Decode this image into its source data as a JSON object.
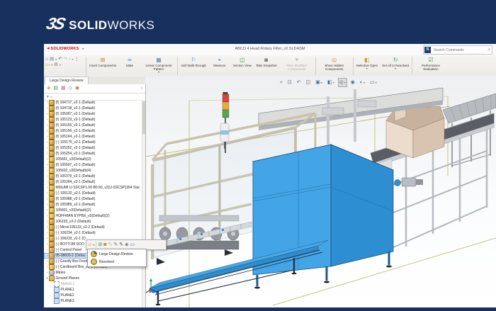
{
  "brand": {
    "mark": "3S",
    "wordmark_bold": "SOLID",
    "wordmark_light": "WORKS"
  },
  "titlebar": {
    "logo": "SOLIDWORKS",
    "menu_arrow": "▸",
    "title": "ABCO 4 Head Rotary Filler_v2.SLDASM",
    "search_badge": "S",
    "search_placeholder": "Search Commands"
  },
  "quick_access": [
    {
      "name": "home",
      "glyph": "⌂",
      "color": "#3a6fb0",
      "drop": false
    },
    {
      "name": "save",
      "glyph": "▤",
      "color": "#5a7db0",
      "drop": true
    },
    {
      "name": "undo",
      "glyph": "↶",
      "color": "#3a6fb0",
      "drop": false
    },
    {
      "name": "redo",
      "glyph": "↷",
      "color": "#b8b6b3",
      "drop": false
    },
    {
      "name": "new-document",
      "glyph": "▫",
      "color": "#c59a2f",
      "drop": true
    },
    {
      "name": "rebuild-traffic-light",
      "glyph": "⋮",
      "color": "#cc3333",
      "drop": false
    },
    {
      "name": "open-folder",
      "glyph": "▭",
      "color": "#c59a2f",
      "drop": true
    },
    {
      "name": "options",
      "glyph": "⚙",
      "color": "#787672",
      "drop": true
    }
  ],
  "commandmanager": {
    "buttons": [
      {
        "label": "Insert Components",
        "glyph": "⊞",
        "color": "#b8862d",
        "enabled": true,
        "group": 0,
        "drop": false
      },
      {
        "label": "Mate",
        "glyph": "∞",
        "color": "#2f7fbf",
        "enabled": true,
        "group": 0,
        "drop": false
      },
      {
        "label": "Linear Component Pattern",
        "glyph": "▦",
        "color": "#6a7fb0",
        "enabled": true,
        "group": 0,
        "drop": true
      },
      {
        "label": "Add Walk-through",
        "glyph": "⚐",
        "color": "#3f7fc0",
        "enabled": true,
        "group": 1,
        "drop": false
      },
      {
        "label": "Measure",
        "glyph": "⌖",
        "color": "#2f7fbf",
        "enabled": true,
        "group": 1,
        "drop": false
      },
      {
        "label": "Section View",
        "glyph": "◫",
        "color": "#3fa14c",
        "enabled": true,
        "group": 1,
        "drop": false
      },
      {
        "label": "Take Snapshot",
        "glyph": "◙",
        "color": "#6f6d6a",
        "enabled": true,
        "group": 1,
        "drop": false
      },
      {
        "label": "Filter Modified Components",
        "glyph": "▼",
        "color": "#c3c1be",
        "enabled": false,
        "group": 1,
        "drop": false
      },
      {
        "label": "Show Hidden Components",
        "glyph": "◎",
        "color": "#c59a2f",
        "enabled": true,
        "group": 2,
        "drop": false
      },
      {
        "label": "Selective Open",
        "glyph": "◧",
        "color": "#c59a2f",
        "enabled": true,
        "group": 3,
        "drop": true
      },
      {
        "label": "Set All to Resolved",
        "glyph": "↻",
        "color": "#3fa14c",
        "enabled": true,
        "group": 3,
        "drop": true
      },
      {
        "label": "Performance Evaluation",
        "glyph": "☑",
        "color": "#3fa14c",
        "enabled": true,
        "group": 4,
        "drop": false
      }
    ]
  },
  "tabs": {
    "active": "Large Design Review"
  },
  "panel": {
    "filter_glyph": "▼",
    "expand_arrow": "›",
    "tabs": [
      {
        "name": "featuremanager-tree-tab",
        "glyph": "◈",
        "color": "#c59a2f"
      },
      {
        "name": "propertymanager-tab",
        "glyph": "▤",
        "color": "#3fa14c"
      },
      {
        "name": "configurationmanager-tab",
        "glyph": "▦",
        "color": "#b86fb0"
      },
      {
        "name": "dimxpertmanager-tab",
        "glyph": "◇",
        "color": "#3a6fb0"
      },
      {
        "name": "displaymanager-tab",
        "glyph": "◉",
        "color": "#d66a2f"
      }
    ]
  },
  "tree": {
    "items": [
      {
        "label": "(f) 104717_v2-1 (Default)",
        "icon": "assembly",
        "expand": "c",
        "indent": 0,
        "selected": false,
        "dimmed": false
      },
      {
        "label": "(f) 104718_v2-1 (Default)",
        "icon": "assembly",
        "expand": "c",
        "indent": 0,
        "selected": false,
        "dimmed": false
      },
      {
        "label": "(f) 105007_v2-1 (Default)",
        "icon": "assembly",
        "expand": "c",
        "indent": 0,
        "selected": false,
        "dimmed": false
      },
      {
        "label": "(f) 105123_v2-1 (Default)",
        "icon": "assembly",
        "expand": "c",
        "indent": 0,
        "selected": false,
        "dimmed": false
      },
      {
        "label": "(f) 105155_v2-1 (Default)",
        "icon": "assembly",
        "expand": "c",
        "indent": 0,
        "selected": false,
        "dimmed": false
      },
      {
        "label": "(f) 105156_v2-1 (Default)",
        "icon": "assembly",
        "expand": "c",
        "indent": 0,
        "selected": false,
        "dimmed": false
      },
      {
        "label": "(f) 105164_v2-1 (Default)",
        "icon": "assembly",
        "expand": "c",
        "indent": 0,
        "selected": false,
        "dimmed": false
      },
      {
        "label": "(-) 105170_v2-1 (Default)",
        "icon": "assembly",
        "expand": "c",
        "indent": 0,
        "selected": false,
        "dimmed": false
      },
      {
        "label": "(f) 105252_v2-1 (Default)",
        "icon": "assembly",
        "expand": "c",
        "indent": 0,
        "selected": false,
        "dimmed": false
      },
      {
        "label": "(f) 105254_v2-1 (Default)",
        "icon": "assembly",
        "expand": "c",
        "indent": 0,
        "selected": false,
        "dimmed": false
      },
      {
        "label": "105601_v2(Default)(2)",
        "icon": "part",
        "expand": "c",
        "indent": 0,
        "selected": false,
        "dimmed": false
      },
      {
        "label": "(f) 105507_v2-1 (Default)",
        "icon": "assembly",
        "expand": "c",
        "indent": 0,
        "selected": false,
        "dimmed": false
      },
      {
        "label": "105602_v2(Default)(4)",
        "icon": "part",
        "expand": "c",
        "indent": 0,
        "selected": false,
        "dimmed": false
      },
      {
        "label": "(f) 105379_v2-1 (Default)",
        "icon": "assembly",
        "expand": "c",
        "indent": 0,
        "selected": false,
        "dimmed": false
      },
      {
        "label": "(f) 105394_v2-1 (Default)",
        "icon": "assembly",
        "expand": "c",
        "indent": 0,
        "selected": false,
        "dimmed": false
      },
      {
        "label": "MISUMI U-SSCSP1.00-B0.50_v2(U-SSCSP)304 Stai",
        "icon": "part",
        "expand": "c",
        "indent": 0,
        "selected": false,
        "dimmed": false
      },
      {
        "label": "(-) 105132_v2-1 (Default)",
        "icon": "assembly",
        "expand": "c",
        "indent": 0,
        "selected": false,
        "dimmed": false
      },
      {
        "label": "(f) 105988_v2-1 (Default)",
        "icon": "assembly",
        "expand": "c",
        "indent": 0,
        "selected": false,
        "dimmed": false
      },
      {
        "label": "(f) 105989_v2-1 (Default)",
        "icon": "assembly",
        "expand": "c",
        "indent": 0,
        "selected": false,
        "dimmed": false
      },
      {
        "label": "105601_v2(Default)(2)",
        "icon": "part",
        "expand": "c",
        "indent": 0,
        "selected": false,
        "dimmed": false
      },
      {
        "label": "HOFFMAN EYPBX_v2(Default)(2)",
        "icon": "part",
        "expand": "c",
        "indent": 0,
        "selected": false,
        "dimmed": false
      },
      {
        "label": "106233_v2-2 (Default)",
        "icon": "assembly",
        "expand": "c",
        "indent": 0,
        "selected": false,
        "dimmed": false
      },
      {
        "label": "(-) Mirror105133_v2-2 (Default)",
        "icon": "assembly",
        "expand": "c",
        "indent": 0,
        "selected": false,
        "dimmed": false
      },
      {
        "label": "(-) 106234_v2-1 (Default)",
        "icon": "assembly",
        "expand": "c",
        "indent": 0,
        "selected": false,
        "dimmed": false
      },
      {
        "label": "(-) 106233_v2-1 (D",
        "icon": "assembly",
        "expand": "c",
        "indent": 0,
        "selected": false,
        "dimmed": false
      },
      {
        "label": "(-) BOTTOM DOO",
        "icon": "assembly",
        "expand": "c",
        "indent": 0,
        "selected": false,
        "dimmed": false
      },
      {
        "label": "(-) Control Panel",
        "icon": "assembly",
        "expand": "c",
        "indent": 0,
        "selected": false,
        "dimmed": false
      },
      {
        "label": "05-08600-2 (Defau",
        "icon": "assembly",
        "expand": "c",
        "indent": 0,
        "selected": true,
        "dimmed": false
      },
      {
        "label": "(-) Gravity Box Feed_v2-1 (Default)",
        "icon": "assembly",
        "expand": "c",
        "indent": 0,
        "selected": false,
        "dimmed": false
      },
      {
        "label": "(-) Cardboard Box_v2-1 (Default)",
        "icon": "part",
        "expand": "c",
        "indent": 0,
        "selected": false,
        "dimmed": false
      },
      {
        "label": "Mates",
        "icon": "mates",
        "expand": "c",
        "indent": 0,
        "selected": false,
        "dimmed": false
      },
      {
        "label": "Ground Planes",
        "icon": "folder",
        "expand": "o",
        "indent": 0,
        "selected": false,
        "dimmed": false
      },
      {
        "label": "Sketch-1",
        "icon": "sketch",
        "expand": null,
        "indent": 1,
        "selected": false,
        "dimmed": true
      },
      {
        "label": "PLANE1",
        "icon": "plane",
        "expand": null,
        "indent": 1,
        "selected": false,
        "dimmed": false
      },
      {
        "label": "PLANE2",
        "icon": "plane",
        "expand": null,
        "indent": 1,
        "selected": false,
        "dimmed": false
      },
      {
        "label": "PLANE3",
        "icon": "plane",
        "expand": null,
        "indent": 1,
        "selected": false,
        "dimmed": false
      }
    ]
  },
  "context_toolbar": {
    "icons": [
      {
        "name": "open-with-dropdown",
        "glyph": "▱",
        "color": "#c59a2f",
        "drop": true,
        "sep": true
      },
      {
        "name": "insert-component",
        "glyph": "⊞",
        "color": "#3fa14c",
        "drop": false,
        "sep": false
      },
      {
        "name": "appearance",
        "glyph": "◙",
        "color": "#b8862d",
        "drop": false,
        "sep": false
      },
      {
        "name": "pen-light",
        "glyph": "✎",
        "color": "#b0b5ba",
        "drop": false,
        "sep": false
      },
      {
        "name": "pen",
        "glyph": "✎",
        "color": "#6a6f74",
        "drop": false,
        "sep": false
      },
      {
        "name": "pen-dark",
        "glyph": "✎",
        "color": "#3a3f44",
        "drop": false,
        "sep": false
      },
      {
        "name": "material",
        "glyph": "◆",
        "color": "#8a8e92",
        "drop": false,
        "sep": false
      },
      {
        "name": "display-states",
        "glyph": "▭",
        "color": "#3a6fb0",
        "drop": false,
        "sep": false
      }
    ]
  },
  "context_menu": {
    "items": [
      {
        "label": "Large Design Review",
        "icon": "ldr"
      },
      {
        "label": "Resolved",
        "icon": "resolved"
      }
    ]
  },
  "headsup": {
    "icons": [
      {
        "name": "zoom-to-fit",
        "glyph": "⌕",
        "drop": false,
        "pressed": false
      },
      {
        "name": "zoom-to-area",
        "glyph": "⊡",
        "drop": false,
        "pressed": false
      },
      {
        "name": "previous-view",
        "glyph": "↶",
        "drop": false,
        "pressed": false
      },
      {
        "name": "section-view",
        "glyph": "◫",
        "drop": false,
        "pressed": false
      },
      {
        "name": "view-orientation",
        "glyph": "▣",
        "drop": true,
        "pressed": false
      },
      {
        "name": "display-style",
        "glyph": "◧",
        "drop": true,
        "pressed": false
      },
      {
        "name": "hide-show-items",
        "glyph": "◎",
        "drop": true,
        "pressed": true
      },
      {
        "name": "edit-appearance",
        "glyph": "◉",
        "drop": false,
        "pressed": false
      },
      {
        "name": "apply-scene",
        "glyph": "◐",
        "drop": true,
        "pressed": false
      },
      {
        "name": "view-settings",
        "glyph": "▭",
        "drop": true,
        "pressed": false
      }
    ]
  },
  "colors": {
    "navy_background": "#17305e",
    "titlebar_logo_red": "#d6001c",
    "selection_highlight": "#cfe2f7",
    "machine_blue": "#44a5e6",
    "frame_tan": "#c9c3ab",
    "belt_gray": "#5a5e64",
    "box_cardboard": "#e6d5c4",
    "sketch_olive": "#aaa83e"
  }
}
